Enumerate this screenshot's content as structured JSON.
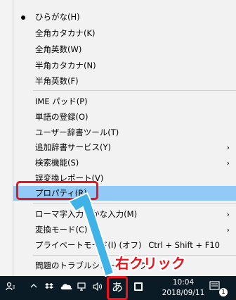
{
  "menu": {
    "items": [
      {
        "label": "ひらがな(H)",
        "checked": true
      },
      {
        "label": "全角カタカナ(K)"
      },
      {
        "label": "全角英数(W)"
      },
      {
        "label": "半角カタカナ(N)"
      },
      {
        "label": "半角英数(F)"
      },
      {
        "label": "IME パッド(P)"
      },
      {
        "label": "単語の登録(O)"
      },
      {
        "label": "ユーザー辞書ツール(T)"
      },
      {
        "label": "追加辞書サービス(Y)"
      },
      {
        "label": "検索機能(S)"
      },
      {
        "label": "誤変換レポート(V)"
      },
      {
        "label": "プロパティ(R)",
        "highlighted": true
      },
      {
        "label": "ローマ字入力 / かな入力(M)"
      },
      {
        "label": "変換モード(C)"
      },
      {
        "label": "プライベートモード(I) (オフ)",
        "shortcut": "Ctrl + Shift + F10"
      },
      {
        "label": "問題のトラブルシューティング"
      }
    ],
    "submenu_arrow": "›"
  },
  "annotation": {
    "text": "右クリック",
    "color": "#e8141d"
  },
  "taskbar": {
    "ime_indicator": "あ",
    "time": "10:04",
    "date": "2018/09/11",
    "notification_count": "1",
    "icons": [
      "people-icon",
      "chevron-up-icon",
      "dropbox-icon",
      "onedrive-icon",
      "network-icon",
      "volume-icon",
      "ime-icon",
      "action-center-icon"
    ]
  },
  "colors": {
    "menu_bg": "#f2f2f2",
    "highlight": "#91c9f7",
    "taskbar_bg": "#0b1b26",
    "arrow": "#3fb3e8"
  }
}
